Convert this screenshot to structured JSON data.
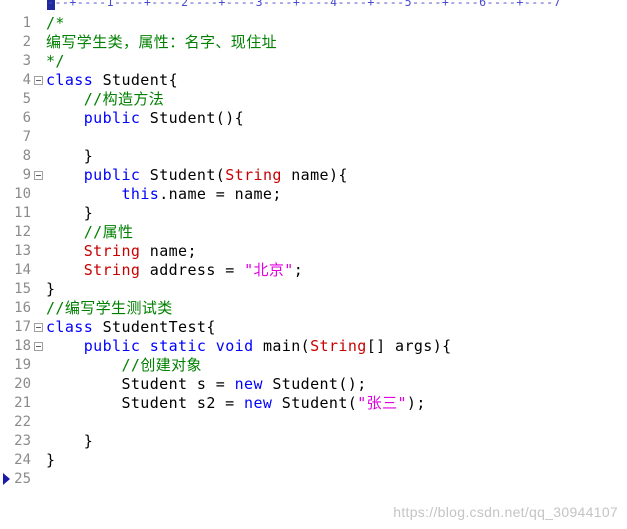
{
  "ruler": {
    "text": "---+----1----+----2----+----3----+----4----+----5----+----6----+----7"
  },
  "lines": [
    {
      "num": "1",
      "fold": false,
      "tokens": [
        {
          "t": "/*",
          "c": "comment"
        }
      ]
    },
    {
      "num": "2",
      "fold": false,
      "tokens": [
        {
          "t": "编写学生类，属性：名字、现住址",
          "c": "comment"
        }
      ]
    },
    {
      "num": "3",
      "fold": false,
      "tokens": [
        {
          "t": "*/",
          "c": "comment"
        }
      ]
    },
    {
      "num": "4",
      "fold": true,
      "tokens": [
        {
          "t": "class",
          "c": "keyword"
        },
        {
          "t": " Student{",
          "c": "plain"
        }
      ]
    },
    {
      "num": "5",
      "fold": false,
      "tokens": [
        {
          "t": "    ",
          "c": "plain"
        },
        {
          "t": "//构造方法",
          "c": "comment"
        }
      ]
    },
    {
      "num": "6",
      "fold": false,
      "tokens": [
        {
          "t": "    ",
          "c": "plain"
        },
        {
          "t": "public",
          "c": "keyword"
        },
        {
          "t": " Student(){",
          "c": "plain"
        }
      ]
    },
    {
      "num": "7",
      "fold": false,
      "tokens": []
    },
    {
      "num": "8",
      "fold": false,
      "tokens": [
        {
          "t": "    }",
          "c": "plain"
        }
      ]
    },
    {
      "num": "9",
      "fold": true,
      "tokens": [
        {
          "t": "    ",
          "c": "plain"
        },
        {
          "t": "public",
          "c": "keyword"
        },
        {
          "t": " Student(",
          "c": "plain"
        },
        {
          "t": "String",
          "c": "type"
        },
        {
          "t": " name){",
          "c": "plain"
        }
      ]
    },
    {
      "num": "10",
      "fold": false,
      "tokens": [
        {
          "t": "        ",
          "c": "plain"
        },
        {
          "t": "this",
          "c": "keyword"
        },
        {
          "t": ".name = name;",
          "c": "plain"
        }
      ]
    },
    {
      "num": "11",
      "fold": false,
      "tokens": [
        {
          "t": "    }",
          "c": "plain"
        }
      ]
    },
    {
      "num": "12",
      "fold": false,
      "tokens": [
        {
          "t": "    ",
          "c": "plain"
        },
        {
          "t": "//属性",
          "c": "comment"
        }
      ]
    },
    {
      "num": "13",
      "fold": false,
      "tokens": [
        {
          "t": "    ",
          "c": "plain"
        },
        {
          "t": "String",
          "c": "type"
        },
        {
          "t": " name;",
          "c": "plain"
        }
      ]
    },
    {
      "num": "14",
      "fold": false,
      "tokens": [
        {
          "t": "    ",
          "c": "plain"
        },
        {
          "t": "String",
          "c": "type"
        },
        {
          "t": " address = ",
          "c": "plain"
        },
        {
          "t": "\"北京\"",
          "c": "string"
        },
        {
          "t": ";",
          "c": "plain"
        }
      ]
    },
    {
      "num": "15",
      "fold": false,
      "tokens": [
        {
          "t": "}",
          "c": "plain"
        }
      ]
    },
    {
      "num": "16",
      "fold": false,
      "tokens": [
        {
          "t": "//编写学生测试类",
          "c": "comment"
        }
      ]
    },
    {
      "num": "17",
      "fold": true,
      "tokens": [
        {
          "t": "class",
          "c": "keyword"
        },
        {
          "t": " StudentTest{",
          "c": "plain"
        }
      ]
    },
    {
      "num": "18",
      "fold": true,
      "tokens": [
        {
          "t": "    ",
          "c": "plain"
        },
        {
          "t": "public",
          "c": "keyword"
        },
        {
          "t": " ",
          "c": "plain"
        },
        {
          "t": "static",
          "c": "keyword"
        },
        {
          "t": " ",
          "c": "plain"
        },
        {
          "t": "void",
          "c": "keyword"
        },
        {
          "t": " main(",
          "c": "plain"
        },
        {
          "t": "String",
          "c": "type"
        },
        {
          "t": "[] args){",
          "c": "plain"
        }
      ]
    },
    {
      "num": "19",
      "fold": false,
      "tokens": [
        {
          "t": "        ",
          "c": "plain"
        },
        {
          "t": "//创建对象",
          "c": "comment"
        }
      ]
    },
    {
      "num": "20",
      "fold": false,
      "tokens": [
        {
          "t": "        Student s = ",
          "c": "plain"
        },
        {
          "t": "new",
          "c": "keyword"
        },
        {
          "t": " Student();",
          "c": "plain"
        }
      ]
    },
    {
      "num": "21",
      "fold": false,
      "tokens": [
        {
          "t": "        Student s2 = ",
          "c": "plain"
        },
        {
          "t": "new",
          "c": "keyword"
        },
        {
          "t": " Student(",
          "c": "plain"
        },
        {
          "t": "\"张三\"",
          "c": "string"
        },
        {
          "t": ");",
          "c": "plain"
        }
      ]
    },
    {
      "num": "22",
      "fold": false,
      "tokens": []
    },
    {
      "num": "23",
      "fold": false,
      "tokens": [
        {
          "t": "    }",
          "c": "plain"
        }
      ]
    },
    {
      "num": "24",
      "fold": false,
      "tokens": [
        {
          "t": "}",
          "c": "plain"
        }
      ]
    },
    {
      "num": "25",
      "fold": false,
      "current": true,
      "tokens": []
    }
  ],
  "colors": {
    "comment": "#008000",
    "keyword": "#0000ff",
    "type": "#c80000",
    "string": "#e000e0",
    "plain": "#000000",
    "line_number": "#8b8b8b"
  },
  "icons": {
    "fold": "fold-minus-box-icon",
    "current_line": "current-line-arrow-icon"
  },
  "watermark": {
    "text": "https://blog.csdn.net/qq_30944107"
  }
}
